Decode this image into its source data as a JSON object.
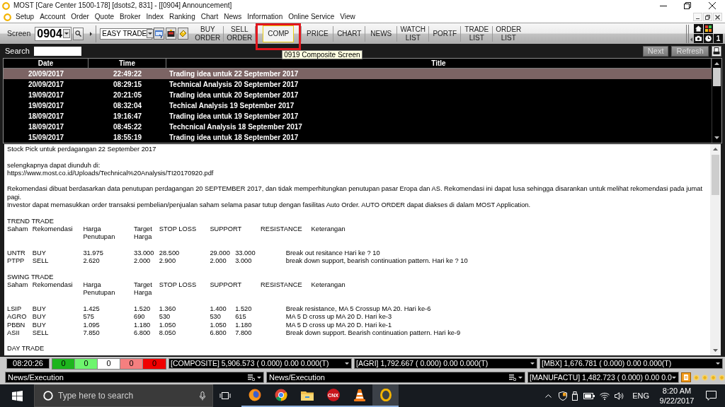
{
  "window": {
    "title": "MOST [Care Center 1500-178] [dsots2, 831] - [[0904] Announcement]"
  },
  "menu": [
    "Setup",
    "Account",
    "Order",
    "Quote",
    "Broker",
    "Index",
    "Ranking",
    "Chart",
    "News",
    "Information",
    "Online Service",
    "View"
  ],
  "toolbar": {
    "screen_label": "Screen",
    "screen_code": "0904",
    "trade_mode": "EASY TRADE",
    "buttons": [
      {
        "label": "BUY ORDER",
        "selected": false,
        "marked": false
      },
      {
        "label": "SELL ORDER",
        "selected": false,
        "marked": false
      },
      {
        "label": "COMP",
        "selected": true,
        "marked": true,
        "tooltip": "0919 Composite Screen"
      },
      {
        "label": "PRICE",
        "selected": false,
        "marked": false
      },
      {
        "label": "CHART",
        "selected": false,
        "marked": false
      },
      {
        "label": "NEWS",
        "selected": false,
        "marked": false
      },
      {
        "label": "WATCH LIST",
        "selected": false,
        "marked": false
      },
      {
        "label": "PORTF",
        "selected": false,
        "marked": false
      },
      {
        "label": "TRADE LIST",
        "selected": false,
        "marked": false
      },
      {
        "label": "ORDER LIST",
        "selected": false,
        "marked": false
      }
    ],
    "page_number": "1"
  },
  "search": {
    "label": "Search",
    "actions": [
      "Next",
      "Refresh"
    ]
  },
  "announcements": {
    "columns": [
      "Date",
      "Time",
      "Title"
    ],
    "rows": [
      {
        "date": "20/09/2017",
        "time": "22:49:22",
        "title": "Trading idea untuk 22 September 2017",
        "selected": true
      },
      {
        "date": "20/09/2017",
        "time": "08:29:15",
        "title": "Technical Analysis 20 September 2017",
        "selected": false
      },
      {
        "date": "19/09/2017",
        "time": "20:21:05",
        "title": "Trading idea untuk 20 September 2017",
        "selected": false
      },
      {
        "date": "19/09/2017",
        "time": "08:32:04",
        "title": "Techical Analysis 19 September 2017",
        "selected": false
      },
      {
        "date": "18/09/2017",
        "time": "19:16:47",
        "title": "Trading idea untuk 19 September 2017",
        "selected": false
      },
      {
        "date": "18/09/2017",
        "time": "08:45:22",
        "title": "Techcnical Analysis 18 September 2017",
        "selected": false
      },
      {
        "date": "15/09/2017",
        "time": "18:55:19",
        "title": "Trading idea untuk 18 September 2017",
        "selected": false
      }
    ]
  },
  "message": [
    {
      "kind": "paragraph",
      "lines": [
        "Stock Pick untuk perdagangan 22 September 2017"
      ]
    },
    {
      "kind": "paragraph",
      "lines": [
        "selengkapnya dapat diunduh di:",
        "https://www.most.co.id/Uploads/Technical%20Analysis/TI20170920.pdf"
      ]
    },
    {
      "kind": "paragraph",
      "lines": [
        "Rekomendasi dibuat berdasarkan data penutupan perdagangan 20 SEPTEMBER 2017, dan tidak memperhitungkan penutupan pasar Eropa dan AS. Rekomendasi ini dapat lusa sehingga disarankan untuk melihat rekomendasi pada jumat pagi.",
        "Investor dapat memasukkan order transaksi pembelian/penjualan saham selama pasar tutup dengan fasilitas Auto Order. AUTO ORDER dapat diakses di dalam MOST Application."
      ]
    },
    {
      "kind": "table",
      "heading": "TREND TRADE",
      "columns": [
        "Saham",
        "Rekomendasi",
        "Harga Penutupan",
        "Target Harga",
        "STOP LOSS",
        "SUPPORT",
        "RESISTANCE",
        "Keterangan"
      ],
      "rows": [
        [
          "UNTR",
          "BUY",
          "31.975",
          "33.000",
          "28.500",
          "29.000",
          "33.000",
          "Break out resitance Hari ke ? 10"
        ],
        [
          "PTPP",
          "SELL",
          "2.620",
          "2.000",
          "2.900",
          "2.000",
          "3.000",
          "break down support, bearish continuation pattern. Hari ke ? 10"
        ]
      ]
    },
    {
      "kind": "table",
      "heading": "SWING TRADE",
      "columns": [
        "Saham",
        "Rekomendasi",
        "Harga Penutupan",
        "Target Harga",
        "STOP LOSS",
        "SUPPORT",
        "RESISTANCE",
        "Keterangan"
      ],
      "rows": [
        [
          "LSIP",
          "BUY",
          "1.425",
          "1.520",
          "1.360",
          "1.400",
          "1.520",
          "Break resistance, MA 5 Crossup MA 20. Hari ke-6"
        ],
        [
          "AGRO",
          "BUY",
          "575",
          "690",
          "530",
          "530",
          "615",
          "MA 5 D cross up MA 20 D. Hari ke-3"
        ],
        [
          "PBBN",
          "BUY",
          "1.095",
          "1.180",
          "1.050",
          "1.050",
          "1.180",
          "MA 5 D cross up MA 20 D. Hari ke-1"
        ],
        [
          "ASII",
          "SELL",
          "7.850",
          "6.800",
          "8.050",
          "6.800",
          "7.800",
          "Break down support. Bearish continuation pattern. Hari ke-9"
        ]
      ]
    },
    {
      "kind": "heading",
      "text": "DAY TRADE"
    }
  ],
  "status": {
    "clock": "08:20:26",
    "counters": [
      {
        "value": "0",
        "color": "#1db51d"
      },
      {
        "value": "0",
        "color": "#6ef56e"
      },
      {
        "value": "0",
        "color": "#ffffff"
      },
      {
        "value": "0",
        "color": "#f57f7f"
      },
      {
        "value": "0",
        "color": "#f00000"
      }
    ],
    "tickers": [
      "[COMPOSITE] 5,906.573 ( 0.000) 0.00 0.000(T)",
      "[AGRI] 1,792.667 ( 0.000) 0.00 0.000(T)",
      "[MBX] 1,676.781 ( 0.000) 0.00 0.000(T)"
    ],
    "feeds": [
      "News/Execution",
      "News/Execution"
    ],
    "sector_ticker": "[MANUFACTU] 1,482.723 ( 0.000) 0.00 0.0"
  },
  "taskbar": {
    "search": {
      "placeholder": "Type here to search"
    },
    "apps": [
      {
        "kind": "globe",
        "running": true,
        "selected": false
      },
      {
        "kind": "wheel",
        "running": true,
        "selected": false
      },
      {
        "kind": "folder",
        "running": true,
        "selected": false
      },
      {
        "kind": "badge",
        "text": "CNX",
        "running": true,
        "selected": false
      },
      {
        "kind": "cone",
        "running": true,
        "selected": false
      },
      {
        "kind": "ring",
        "running": true,
        "selected": true
      }
    ],
    "language": "ENG",
    "time": "8:20 AM",
    "date": "9/22/2017"
  }
}
